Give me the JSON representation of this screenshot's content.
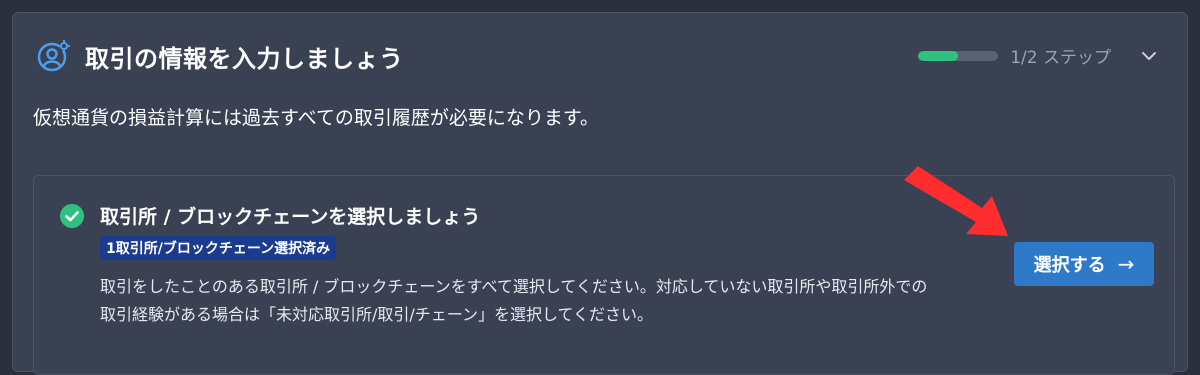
{
  "header": {
    "title": "取引の情報を入力しましょう",
    "icon": "user-gear-icon",
    "progress_label": "1/2 ステップ",
    "progress": 0.5
  },
  "subtitle": "仮想通貨の損益計算には過去すべての取引履歴が必要になります。",
  "step": {
    "title": "取引所 / ブロックチェーンを選択しましょう",
    "badge": "1取引所/ブロックチェーン選択済み",
    "description": "取引をしたことのある取引所 / ブロックチェーンをすべて選択してください。対応していない取引所や取引所外での取引経験がある場合は「未対応取引所/取引/チェーン」を選択してください。",
    "button_label": "選択する",
    "button_arrow": "→"
  },
  "colors": {
    "background": "#2a303d",
    "card": "#394152",
    "progress_fill": "#2ec27e",
    "badge": "#1b3c8e",
    "button": "#2f7ac8",
    "check": "#2ec27e",
    "pointer_arrow": "#ff2d2d"
  }
}
